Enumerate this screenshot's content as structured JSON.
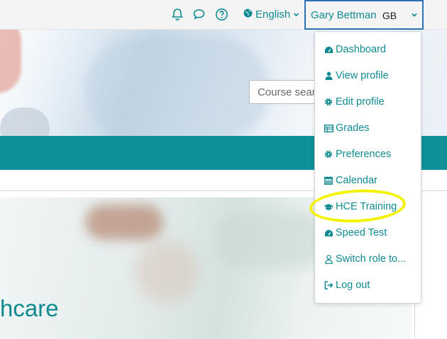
{
  "colors": {
    "accent": "#0f8a91",
    "band": "#0f8f98",
    "focus_border": "#2a72b5",
    "highlight": "#f5f200"
  },
  "navbar": {
    "icons": [
      "bell-icon",
      "chat-bubble-icon",
      "help-circle-icon"
    ],
    "language": {
      "icon": "globe-icon",
      "label": "English"
    },
    "user": {
      "name": "Gary Bettman",
      "initials": "GB"
    }
  },
  "search": {
    "placeholder": "Course sear"
  },
  "banner": {
    "title": "hcare"
  },
  "user_menu": {
    "items": [
      {
        "label": "Dashboard",
        "icon": "tachometer-icon"
      },
      {
        "label": "View profile",
        "icon": "user-icon"
      },
      {
        "label": "Edit profile",
        "icon": "cog-icon"
      },
      {
        "label": "Grades",
        "icon": "table-icon"
      },
      {
        "label": "Preferences",
        "icon": "wrench-icon"
      },
      {
        "label": "Calendar",
        "icon": "calendar-icon"
      },
      {
        "label": "HCE Training",
        "icon": "graduation-cap-icon",
        "highlighted": true
      },
      {
        "label": "Speed Test",
        "icon": "tachometer-icon"
      },
      {
        "label": "Switch role to...",
        "icon": "user-outline-icon"
      },
      {
        "label": "Log out",
        "icon": "sign-out-icon"
      }
    ]
  }
}
